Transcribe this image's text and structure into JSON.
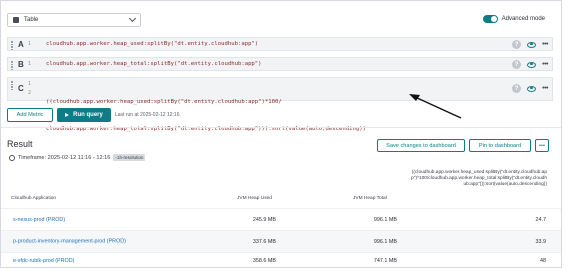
{
  "header": {
    "visualization": {
      "label": "Table",
      "icon": "table-icon"
    },
    "advanced_mode": {
      "label": "Advanced mode",
      "enabled": true
    }
  },
  "queries": [
    {
      "letter": "A",
      "lines": [
        "1"
      ],
      "code": [
        "cloudhub.app.worker.heap_used:splitBy(\"dt.entity.cloudhub:app\")"
      ]
    },
    {
      "letter": "B",
      "lines": [
        "1"
      ],
      "code": [
        "cloudhub.app.worker.heap_total:splitBy(\"dt.entity.cloudhub:app\")"
      ]
    },
    {
      "letter": "C",
      "lines": [
        "1",
        "2"
      ],
      "code": [
        "((cloudhub.app.worker.heap_used:splitBy(\"dt.entity.cloudhub:app\")*100/",
        "cloudhub.app.worker.heap_total:splitBy(\"dt.entity.cloudhub:app\"))):sort(value(auto,descending))"
      ]
    }
  ],
  "query_actions": {
    "help": "?",
    "more": "•••"
  },
  "toolbar": {
    "add_metric": "Add Metric",
    "run_query": "Run query",
    "last_run": "Last run at 2025-02-12 12:16"
  },
  "result": {
    "title": "Result",
    "timeframe_label": "Timeframe: 2025-02-12 11:16 - 12:16",
    "timeframe_badge": "-1h-resolution",
    "save_button": "Save changes to dashboard",
    "pin_button": "Pin to dashboard",
    "more_button": "•••"
  },
  "table": {
    "columns": [
      "Cloudhub Application",
      "JVM Heap Used",
      "JVM Heap Total",
      "((cloudhub.app.worker.heap_used:splitBy(\"dt.entity.cloudhub:app\")*100/cloudhub.app.worker.heap_total:splitBy(\"dt.entity.cloudhub:app\"))):sort(value(auto,descending))"
    ],
    "rows": [
      {
        "app": "s-nexus-prod (PROD)",
        "used": "245.9 MB",
        "total": "996.1 MB",
        "pct": "24.7"
      },
      {
        "app": "p-product-inventory-management-prod (PROD)",
        "used": "337.6 MB",
        "total": "996.1 MB",
        "pct": "33.9"
      },
      {
        "app": "e-sfdc-rubik-prod (PROD)",
        "used": "358.6 MB",
        "total": "747.1 MB",
        "pct": "48"
      }
    ]
  },
  "colors": {
    "accent": "#0e7c86",
    "link": "#1f6fb5",
    "query_text": "#8a2b2b"
  }
}
